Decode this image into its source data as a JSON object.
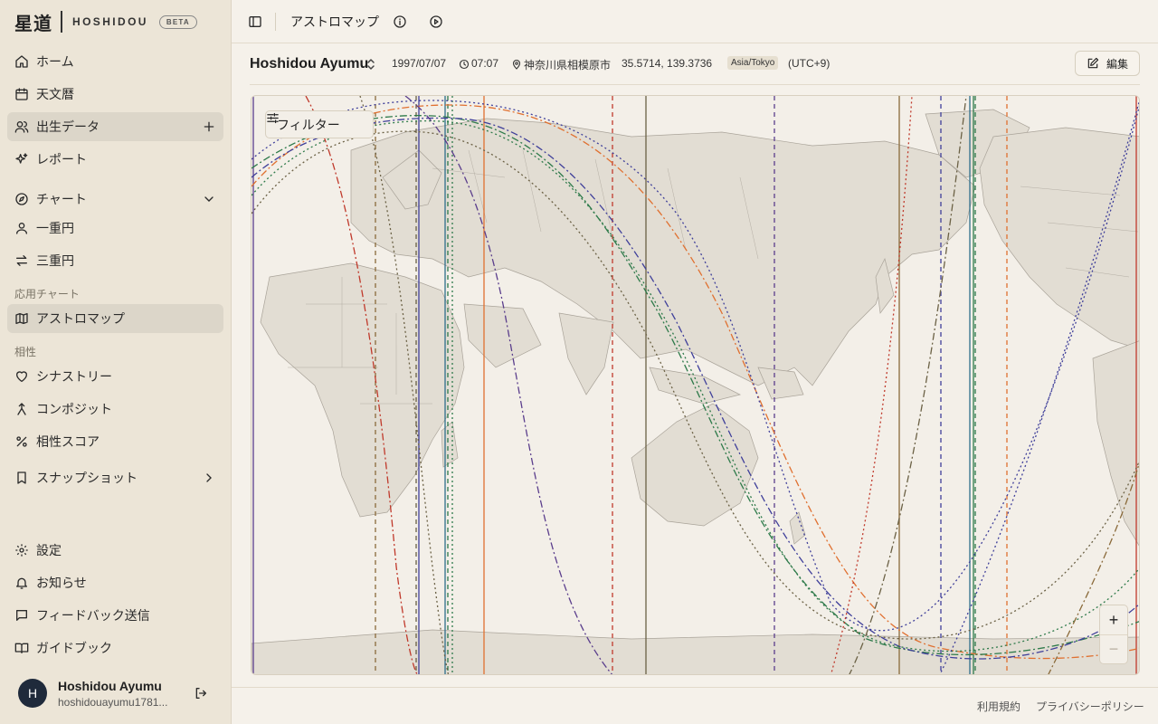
{
  "brand": {
    "kanji": "星道",
    "name": "HOSHIDOU",
    "badge": "BETA"
  },
  "sidebar": {
    "main": [
      {
        "label": "ホーム",
        "icon": "home-icon"
      },
      {
        "label": "天文暦",
        "icon": "calendar-icon"
      },
      {
        "label": "出生データ",
        "icon": "users-icon"
      },
      {
        "label": "レポート",
        "icon": "sparkles-icon"
      }
    ],
    "chart_group": {
      "label": "チャート",
      "icon": "compass-icon"
    },
    "charts": [
      {
        "label": "一重円",
        "icon": "user-icon"
      },
      {
        "label": "三重円",
        "icon": "arrows-swap-icon"
      }
    ],
    "applied_label": "応用チャート",
    "applied": [
      {
        "label": "アストロマップ",
        "icon": "map-icon"
      }
    ],
    "compat_label": "相性",
    "compat": [
      {
        "label": "シナストリー",
        "icon": "heart-icon"
      },
      {
        "label": "コンポジット",
        "icon": "merge-icon"
      },
      {
        "label": "相性スコア",
        "icon": "percent-icon"
      }
    ],
    "snapshot": {
      "label": "スナップショット",
      "icon": "bookmark-icon"
    },
    "bottom": [
      {
        "label": "設定",
        "icon": "gear-icon"
      },
      {
        "label": "お知らせ",
        "icon": "bell-icon"
      },
      {
        "label": "フィードバック送信",
        "icon": "chat-icon"
      },
      {
        "label": "ガイドブック",
        "icon": "book-icon"
      }
    ]
  },
  "user": {
    "initial": "H",
    "name": "Hoshidou Ayumu",
    "email": "hoshidouayumu1781..."
  },
  "topbar": {
    "title": "アストロマップ"
  },
  "subject": {
    "name": "Hoshidou Ayumu",
    "date": "1997/07/07",
    "time": "07:07",
    "place": "神奈川県相模原市",
    "coords": "35.5714, 139.3736",
    "timezone": "Asia/Tokyo",
    "offset": "(UTC+9)",
    "edit_label": "編集"
  },
  "map": {
    "filter_label": "フィルター",
    "zoom_in": "+",
    "zoom_out": "−"
  },
  "footer": {
    "terms": "利用規約",
    "privacy": "プライバシーポリシー"
  }
}
